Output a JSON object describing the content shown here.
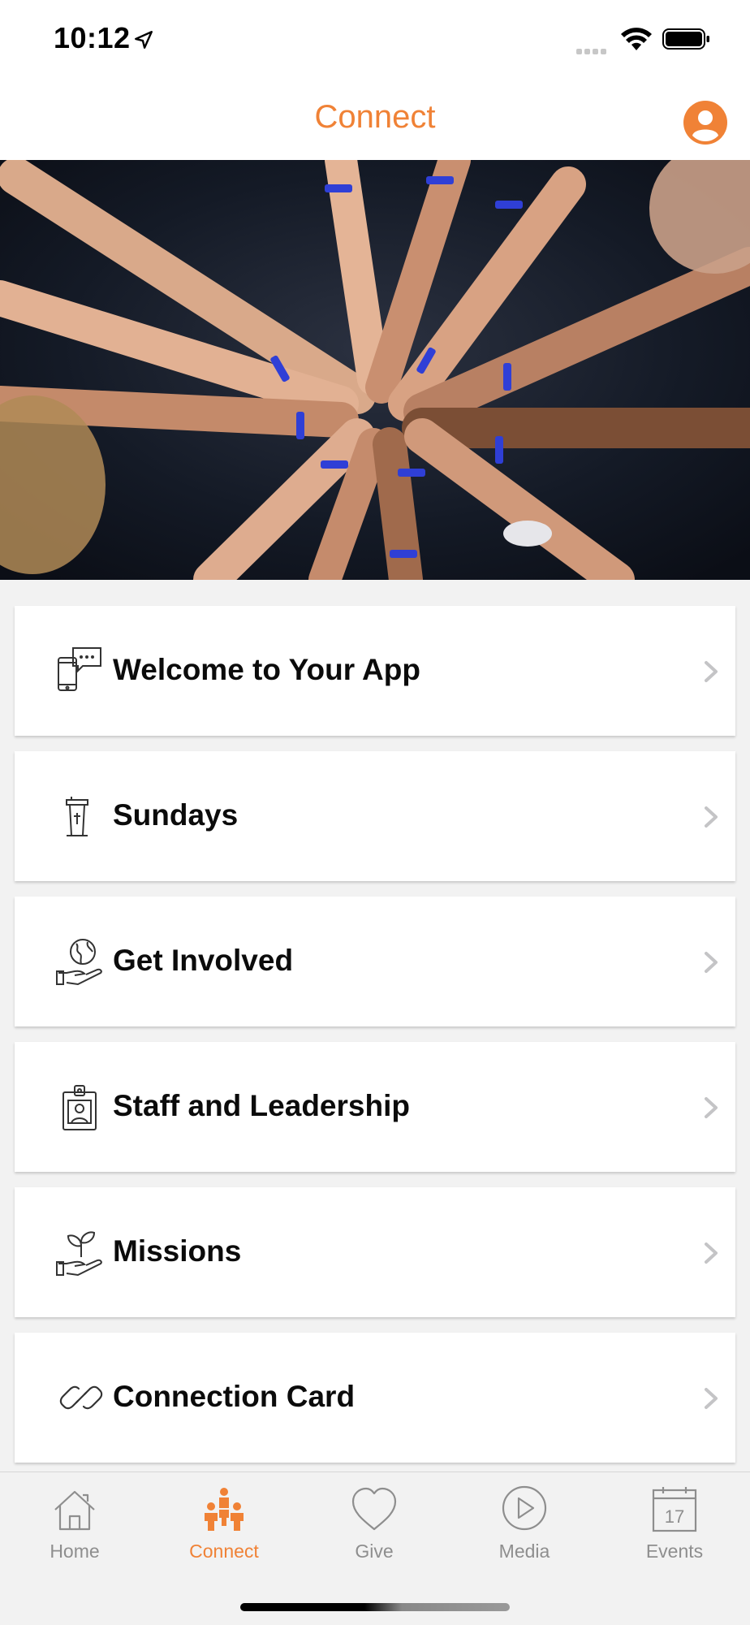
{
  "status_bar": {
    "time": "10:12"
  },
  "header": {
    "title": "Connect"
  },
  "menu": [
    {
      "label": "Welcome to Your App",
      "icon": "phone-chat-icon"
    },
    {
      "label": "Sundays",
      "icon": "pulpit-icon"
    },
    {
      "label": "Get Involved",
      "icon": "globe-hand-icon"
    },
    {
      "label": "Staff and Leadership",
      "icon": "staff-badge-icon"
    },
    {
      "label": "Missions",
      "icon": "plant-hand-icon"
    },
    {
      "label": "Connection Card",
      "icon": "link-icon"
    }
  ],
  "tabs": [
    {
      "label": "Home",
      "icon": "home-icon",
      "active": false
    },
    {
      "label": "Connect",
      "icon": "people-icon",
      "active": true
    },
    {
      "label": "Give",
      "icon": "heart-icon",
      "active": false
    },
    {
      "label": "Media",
      "icon": "play-icon",
      "active": false
    },
    {
      "label": "Events",
      "icon": "calendar-icon",
      "active": false
    }
  ],
  "events_tab_day": "17",
  "colors": {
    "accent": "#f08236",
    "tab_inactive": "#8e8e8e",
    "background": "#f2f2f2"
  },
  "hero_image": "hands-together-photo"
}
